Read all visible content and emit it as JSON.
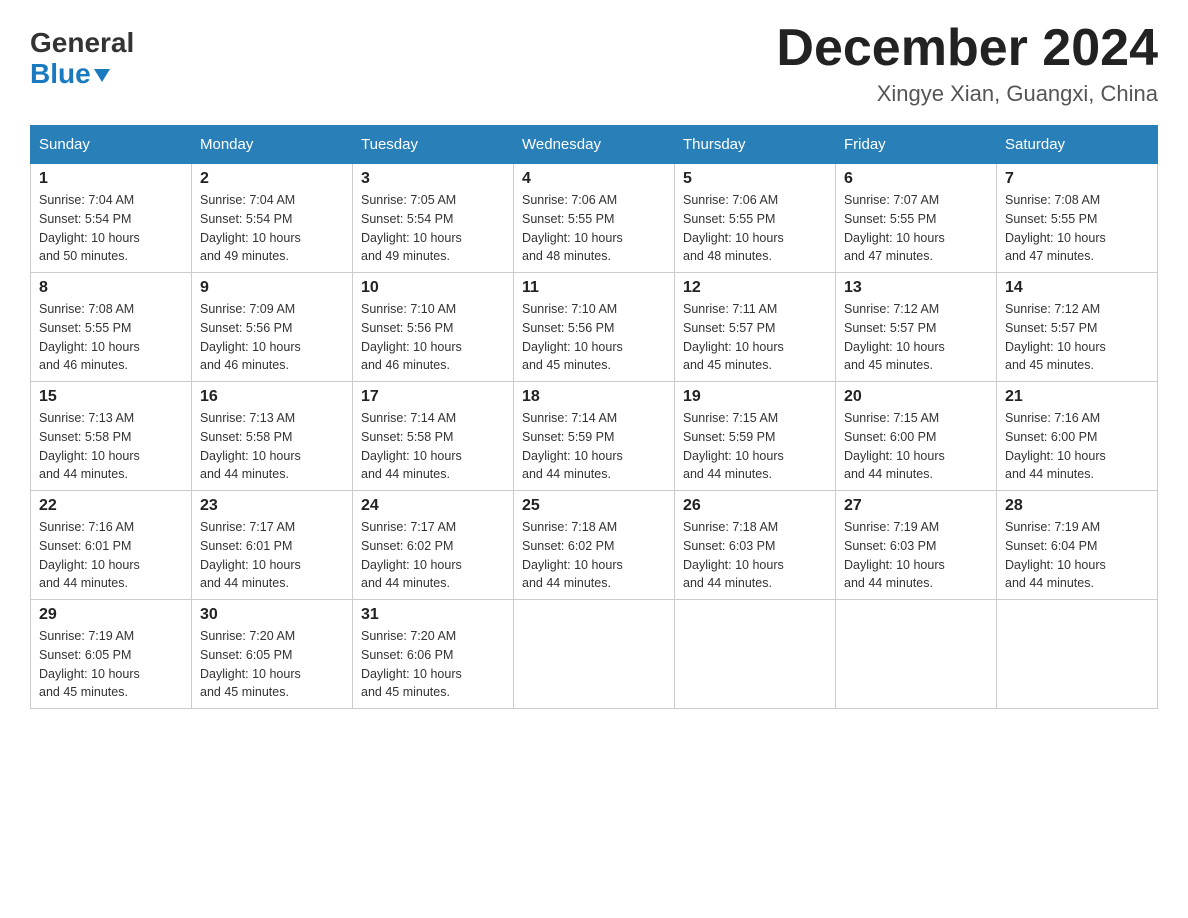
{
  "logo": {
    "general": "General",
    "blue": "Blue"
  },
  "title": "December 2024",
  "subtitle": "Xingye Xian, Guangxi, China",
  "days_of_week": [
    "Sunday",
    "Monday",
    "Tuesday",
    "Wednesday",
    "Thursday",
    "Friday",
    "Saturday"
  ],
  "weeks": [
    [
      {
        "day": "1",
        "sunrise": "7:04 AM",
        "sunset": "5:54 PM",
        "daylight": "10 hours and 50 minutes."
      },
      {
        "day": "2",
        "sunrise": "7:04 AM",
        "sunset": "5:54 PM",
        "daylight": "10 hours and 49 minutes."
      },
      {
        "day": "3",
        "sunrise": "7:05 AM",
        "sunset": "5:54 PM",
        "daylight": "10 hours and 49 minutes."
      },
      {
        "day": "4",
        "sunrise": "7:06 AM",
        "sunset": "5:55 PM",
        "daylight": "10 hours and 48 minutes."
      },
      {
        "day": "5",
        "sunrise": "7:06 AM",
        "sunset": "5:55 PM",
        "daylight": "10 hours and 48 minutes."
      },
      {
        "day": "6",
        "sunrise": "7:07 AM",
        "sunset": "5:55 PM",
        "daylight": "10 hours and 47 minutes."
      },
      {
        "day": "7",
        "sunrise": "7:08 AM",
        "sunset": "5:55 PM",
        "daylight": "10 hours and 47 minutes."
      }
    ],
    [
      {
        "day": "8",
        "sunrise": "7:08 AM",
        "sunset": "5:55 PM",
        "daylight": "10 hours and 46 minutes."
      },
      {
        "day": "9",
        "sunrise": "7:09 AM",
        "sunset": "5:56 PM",
        "daylight": "10 hours and 46 minutes."
      },
      {
        "day": "10",
        "sunrise": "7:10 AM",
        "sunset": "5:56 PM",
        "daylight": "10 hours and 46 minutes."
      },
      {
        "day": "11",
        "sunrise": "7:10 AM",
        "sunset": "5:56 PM",
        "daylight": "10 hours and 45 minutes."
      },
      {
        "day": "12",
        "sunrise": "7:11 AM",
        "sunset": "5:57 PM",
        "daylight": "10 hours and 45 minutes."
      },
      {
        "day": "13",
        "sunrise": "7:12 AM",
        "sunset": "5:57 PM",
        "daylight": "10 hours and 45 minutes."
      },
      {
        "day": "14",
        "sunrise": "7:12 AM",
        "sunset": "5:57 PM",
        "daylight": "10 hours and 45 minutes."
      }
    ],
    [
      {
        "day": "15",
        "sunrise": "7:13 AM",
        "sunset": "5:58 PM",
        "daylight": "10 hours and 44 minutes."
      },
      {
        "day": "16",
        "sunrise": "7:13 AM",
        "sunset": "5:58 PM",
        "daylight": "10 hours and 44 minutes."
      },
      {
        "day": "17",
        "sunrise": "7:14 AM",
        "sunset": "5:58 PM",
        "daylight": "10 hours and 44 minutes."
      },
      {
        "day": "18",
        "sunrise": "7:14 AM",
        "sunset": "5:59 PM",
        "daylight": "10 hours and 44 minutes."
      },
      {
        "day": "19",
        "sunrise": "7:15 AM",
        "sunset": "5:59 PM",
        "daylight": "10 hours and 44 minutes."
      },
      {
        "day": "20",
        "sunrise": "7:15 AM",
        "sunset": "6:00 PM",
        "daylight": "10 hours and 44 minutes."
      },
      {
        "day": "21",
        "sunrise": "7:16 AM",
        "sunset": "6:00 PM",
        "daylight": "10 hours and 44 minutes."
      }
    ],
    [
      {
        "day": "22",
        "sunrise": "7:16 AM",
        "sunset": "6:01 PM",
        "daylight": "10 hours and 44 minutes."
      },
      {
        "day": "23",
        "sunrise": "7:17 AM",
        "sunset": "6:01 PM",
        "daylight": "10 hours and 44 minutes."
      },
      {
        "day": "24",
        "sunrise": "7:17 AM",
        "sunset": "6:02 PM",
        "daylight": "10 hours and 44 minutes."
      },
      {
        "day": "25",
        "sunrise": "7:18 AM",
        "sunset": "6:02 PM",
        "daylight": "10 hours and 44 minutes."
      },
      {
        "day": "26",
        "sunrise": "7:18 AM",
        "sunset": "6:03 PM",
        "daylight": "10 hours and 44 minutes."
      },
      {
        "day": "27",
        "sunrise": "7:19 AM",
        "sunset": "6:03 PM",
        "daylight": "10 hours and 44 minutes."
      },
      {
        "day": "28",
        "sunrise": "7:19 AM",
        "sunset": "6:04 PM",
        "daylight": "10 hours and 44 minutes."
      }
    ],
    [
      {
        "day": "29",
        "sunrise": "7:19 AM",
        "sunset": "6:05 PM",
        "daylight": "10 hours and 45 minutes."
      },
      {
        "day": "30",
        "sunrise": "7:20 AM",
        "sunset": "6:05 PM",
        "daylight": "10 hours and 45 minutes."
      },
      {
        "day": "31",
        "sunrise": "7:20 AM",
        "sunset": "6:06 PM",
        "daylight": "10 hours and 45 minutes."
      },
      null,
      null,
      null,
      null
    ]
  ],
  "labels": {
    "sunrise": "Sunrise:",
    "sunset": "Sunset:",
    "daylight": "Daylight:"
  }
}
